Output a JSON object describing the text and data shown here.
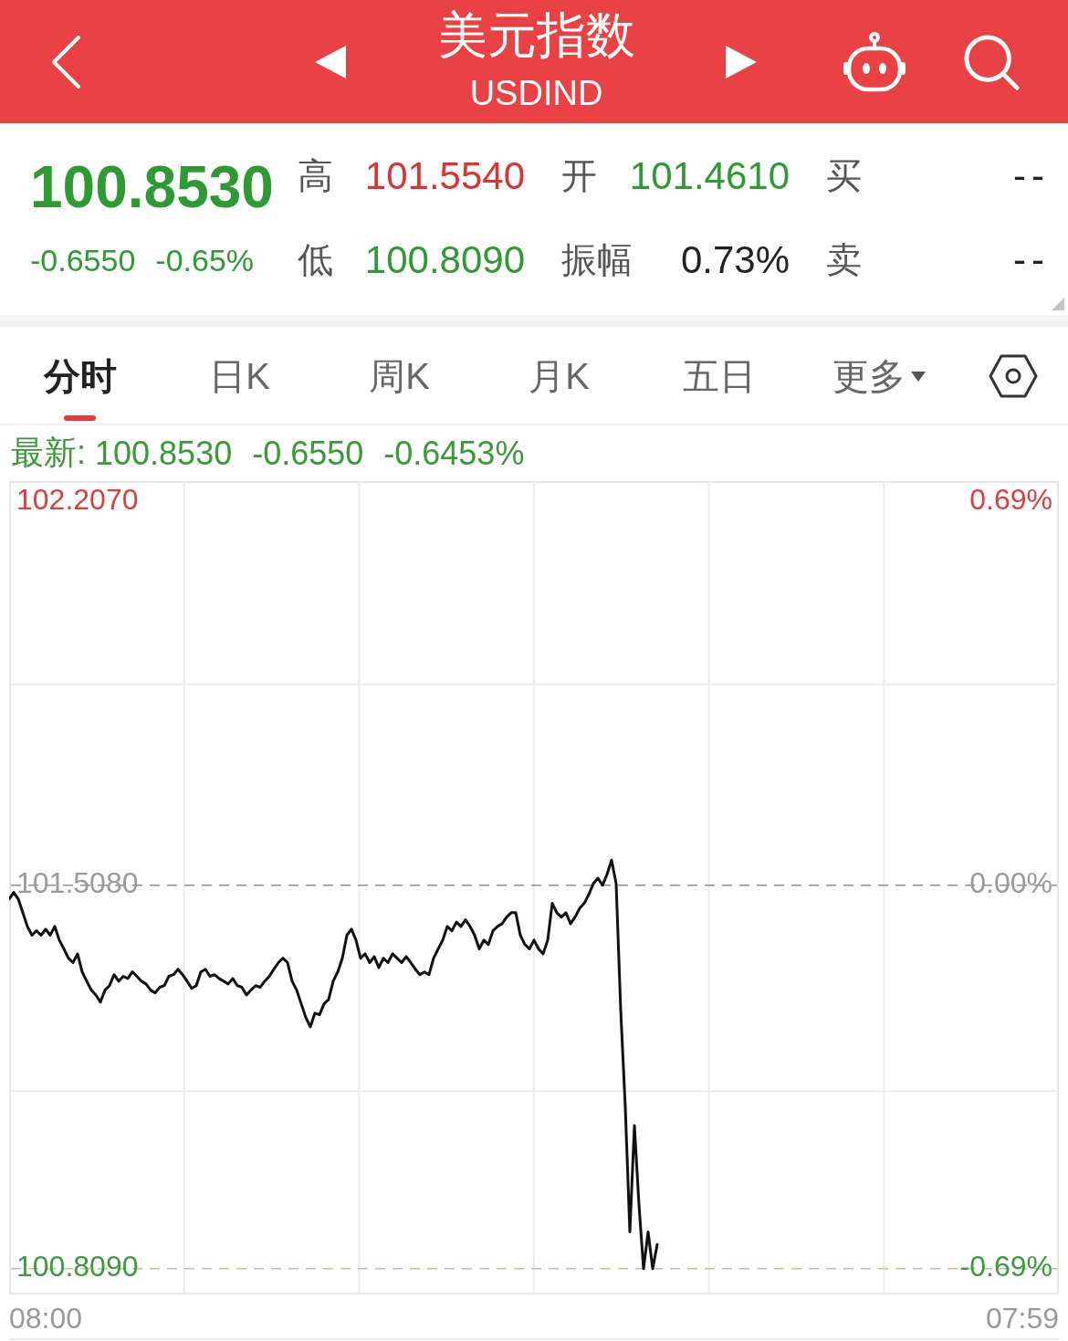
{
  "header": {
    "title": "美元指数",
    "symbol": "USDIND"
  },
  "quote": {
    "price": "100.8530",
    "change": "-0.6550",
    "change_percent": "-0.65%",
    "color": "#2e9a33"
  },
  "stats": [
    {
      "label": "高",
      "value": "101.5540",
      "color": "#e0302f"
    },
    {
      "label": "开",
      "value": "101.4610",
      "color": "#2e9a33"
    },
    {
      "label": "买",
      "value": "--",
      "color": "#222222"
    },
    {
      "label": "低",
      "value": "100.8090",
      "color": "#2e9a33"
    },
    {
      "label": "振幅",
      "value": "0.73%",
      "color": "#222222"
    },
    {
      "label": "卖",
      "value": "--",
      "color": "#222222"
    }
  ],
  "tabs": [
    {
      "label": "分时",
      "selected": true,
      "kind": "tab"
    },
    {
      "label": "日K",
      "selected": false,
      "kind": "tab"
    },
    {
      "label": "周K",
      "selected": false,
      "kind": "tab"
    },
    {
      "label": "月K",
      "selected": false,
      "kind": "tab"
    },
    {
      "label": "五日",
      "selected": false,
      "kind": "tab"
    },
    {
      "label": "更多",
      "selected": false,
      "kind": "dropdown"
    }
  ],
  "chart": {
    "latest": {
      "label": "最新:",
      "price": "100.8530",
      "change": "-0.6550",
      "change_percent": "-0.6453%",
      "color": "#3a9a3a"
    },
    "chart_data": {
      "type": "line",
      "categories": [
        null,
        null,
        null,
        null,
        null,
        null,
        null,
        null,
        "08:00",
        null,
        null,
        null,
        null,
        null,
        null,
        null,
        null,
        null,
        null,
        null,
        null,
        null,
        null,
        null,
        null,
        null,
        null,
        null,
        null,
        null,
        null,
        null,
        null,
        null,
        null,
        null,
        null,
        null,
        null,
        null,
        null,
        null,
        null,
        null,
        null,
        null,
        null,
        null,
        null,
        null,
        null,
        null,
        null,
        null,
        null,
        null,
        null,
        null,
        null,
        null,
        null,
        null,
        null,
        null,
        null,
        null,
        null,
        null,
        null,
        null,
        null,
        null,
        null,
        null,
        null,
        null,
        null,
        null,
        null,
        null,
        null,
        null,
        null,
        null,
        null,
        null,
        null,
        null,
        null,
        null,
        null,
        null,
        null,
        null,
        null,
        null,
        null,
        null,
        null,
        null,
        null,
        null,
        null,
        null,
        null,
        null,
        null,
        null,
        null,
        null,
        null,
        null,
        null,
        null,
        null,
        null,
        null,
        null,
        null,
        null,
        null,
        null,
        null,
        null,
        null,
        null,
        null,
        null,
        null,
        null,
        null,
        null,
        null,
        null,
        null,
        null,
        null,
        null,
        null,
        null,
        null,
        null,
        null,
        null,
        null,
        null,
        null,
        null,
        null,
        null,
        null,
        null,
        null,
        null,
        null,
        null,
        null,
        null,
        null,
        null,
        null,
        null,
        null,
        null,
        null,
        null,
        null,
        null,
        null,
        null,
        null,
        null,
        null,
        null,
        null,
        null,
        null,
        null,
        null,
        null,
        null,
        null,
        null,
        null,
        null,
        null,
        null,
        null,
        null,
        null,
        null,
        null,
        null,
        null,
        null,
        null,
        null,
        null,
        null,
        null,
        null,
        null,
        null,
        null,
        null,
        null,
        null,
        null,
        null,
        null,
        null,
        null,
        null,
        null,
        null,
        null,
        null,
        null,
        null,
        null,
        null,
        null,
        "07:59",
        null,
        null,
        null,
        null,
        null,
        null,
        null,
        null
      ],
      "ylim": [
        100.762,
        102.245
      ],
      "yticks": [
        {
          "value": 102.207,
          "label": "102.2070"
        },
        {
          "value": 101.508,
          "label": "101.5080"
        },
        {
          "value": 100.809,
          "label": "100.8090"
        }
      ],
      "series": [
        {
          "color": "#111111",
          "values": [
            101.483,
            101.495,
            101.483,
            101.458,
            101.433,
            101.417,
            101.425,
            101.417,
            101.428,
            101.417,
            101.433,
            101.408,
            101.392,
            101.375,
            101.367,
            101.383,
            101.35,
            101.333,
            101.317,
            101.308,
            101.295,
            101.317,
            101.325,
            101.345,
            101.333,
            101.342,
            101.338,
            101.35,
            101.342,
            101.333,
            101.328,
            101.317,
            101.312,
            101.322,
            101.325,
            101.342,
            101.345,
            101.355,
            101.345,
            101.333,
            101.32,
            101.325,
            101.35,
            101.355,
            101.342,
            101.345,
            101.338,
            101.333,
            101.328,
            101.338,
            101.325,
            101.322,
            101.308,
            101.317,
            101.325,
            101.322,
            101.333,
            101.342,
            101.355,
            101.367,
            101.375,
            101.367,
            101.333,
            101.317,
            101.292,
            101.267,
            101.25,
            101.275,
            101.272,
            101.292,
            101.3,
            101.333,
            101.35,
            101.375,
            101.417,
            101.428,
            101.408,
            101.375,
            101.383,
            101.367,
            101.378,
            101.358,
            101.375,
            101.367,
            101.383,
            101.375,
            101.367,
            101.378,
            101.367,
            101.355,
            101.345,
            101.35,
            101.345,
            101.375,
            101.392,
            101.408,
            101.433,
            101.425,
            101.441,
            101.433,
            101.445,
            101.433,
            101.417,
            101.392,
            101.408,
            101.4,
            101.425,
            101.433,
            101.438,
            101.45,
            101.458,
            101.458,
            101.417,
            101.4,
            101.392,
            101.408,
            101.392,
            101.383,
            101.408,
            101.475,
            101.458,
            101.45,
            101.458,
            101.438,
            101.45,
            101.466,
            101.475,
            101.491,
            101.511,
            101.521,
            101.508,
            101.528,
            101.554,
            101.511,
            101.28,
            101.104,
            100.876,
            101.07,
            100.926,
            100.809,
            100.876,
            100.809,
            100.853,
            null,
            null,
            null,
            null,
            null,
            null,
            null,
            null,
            null,
            null,
            null,
            null,
            null,
            null,
            null,
            null,
            null,
            null,
            null,
            null,
            null,
            null,
            null,
            null,
            null,
            null,
            null,
            null,
            null,
            null,
            null,
            null,
            null,
            null,
            null,
            null,
            null,
            null,
            null,
            null,
            null,
            null,
            null,
            null,
            null,
            null,
            null,
            null,
            null,
            null,
            null,
            null,
            null,
            null,
            null,
            null,
            null,
            null,
            null,
            null,
            null,
            null,
            null,
            null,
            null,
            null,
            null,
            null,
            null,
            null,
            null,
            null,
            null,
            null,
            null,
            null,
            null,
            null,
            null,
            null,
            null,
            null,
            null,
            null,
            null,
            null,
            null,
            null
          ]
        }
      ],
      "ref_lines": [
        {
          "axis": "y",
          "value": 101.508,
          "color": "#8f8f8f"
        },
        {
          "axis": "y",
          "value": 100.809,
          "color": "#b5c6a2"
        }
      ],
      "annotations": [
        "0.69%",
        "0.00%",
        "-0.69%"
      ]
    }
  }
}
